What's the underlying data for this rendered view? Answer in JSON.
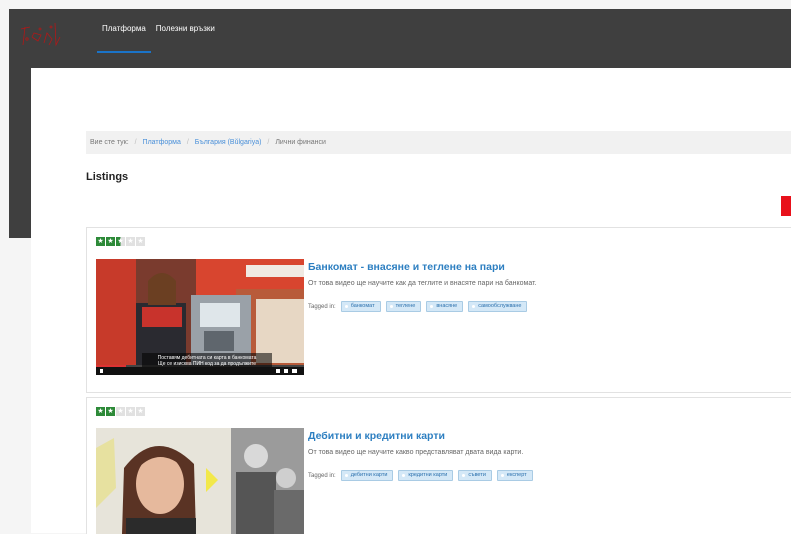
{
  "nav": {
    "items": [
      {
        "label": "Платформа",
        "active": true
      },
      {
        "label": "Полезни връзки",
        "active": false
      }
    ]
  },
  "breadcrumb": {
    "prefix": "Вие сте тук:",
    "items": [
      "Платформа",
      "България (Bŭlgariya)",
      "Лични финанси"
    ]
  },
  "page": {
    "title": "Listings"
  },
  "listings": [
    {
      "rating": 2.5,
      "title": "Банкомат - внасяне и теглене на пари",
      "description": "От това видео ще научите как да теглите и внасяте пари на банкомат.",
      "tagged_label": "Tagged in:",
      "tags": [
        "банкомат",
        "теглене",
        "внасяне",
        "самообслужване"
      ],
      "subtitle": "Поставям дебитната си карта в банкомата",
      "subtitle2": "Ще се изисква ПИН код за да продължите"
    },
    {
      "rating": 2,
      "title": "Дебитни и кредитни карти",
      "description": "От това видео ще научите какво представляват двата вида карти.",
      "tagged_label": "Tagged in:",
      "tags": [
        "дебитни карти",
        "кредитни карти",
        "съвети",
        "експерт"
      ]
    }
  ],
  "colors": {
    "topbar": "#3f3f3f",
    "accent": "#2d7fc1",
    "rating": "#2d8a38",
    "red_button": "#e8111b"
  }
}
